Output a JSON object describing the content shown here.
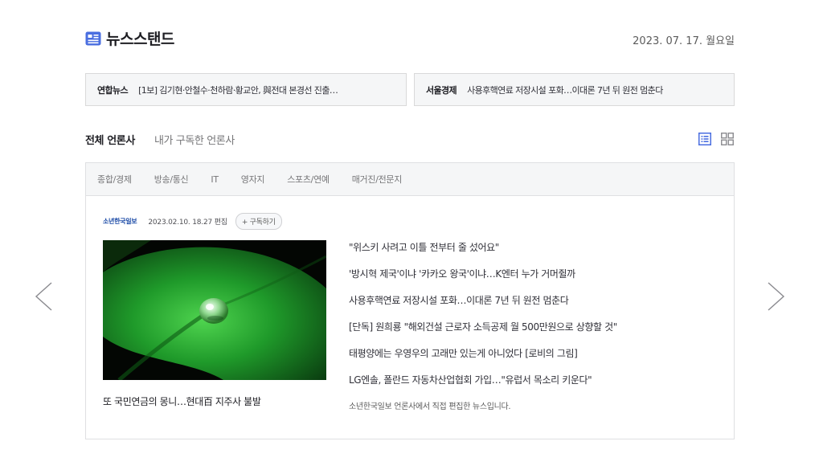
{
  "header": {
    "logo_icon": "newspaper-icon",
    "brand_color": "#4a6ee0",
    "title": "뉴스스탠드",
    "date": "2023. 07. 17. 월요일"
  },
  "rolling": [
    {
      "press": "연합뉴스",
      "headline": "[1보] 김기현·안철수·천하람·황교안, 與전대 본경선 진출…"
    },
    {
      "press": "서울경제",
      "headline": "사용후핵연료 저장시설 포화…이대론 7년 뒤 원전 멈춘다"
    }
  ],
  "tabs": {
    "all": "전체 언론사",
    "subscribed": "내가 구독한 언론사"
  },
  "view_icons": [
    "list-view-icon",
    "grid-view-icon"
  ],
  "categories": [
    "종합/경제",
    "방송/통신",
    "IT",
    "영자지",
    "스포츠/연예",
    "매거진/전문지"
  ],
  "press": {
    "name": "소년한국일보",
    "edit_time": "2023.02.10. 18.27 편집",
    "subscribe_label": "+ 구독하기",
    "main_caption": "또 국민연금의 몽니…현대百 지주사 불발",
    "news": [
      "\"위스키 사려고 이틀 전부터 줄 섰어요\"",
      "'방시혁 제국'이냐 '카카오 왕국'이냐…K엔터 누가 거머쥘까",
      "사용후핵연료 저장시설 포화…이대론 7년 뒤 원전 멈춘다",
      "[단독] 원희룡 \"해외건설 근로자 소득공제 월 500만원으로 상향할 것\"",
      "태평양에는 우영우의 고래만 있는게 아니었다 [로비의 그림]",
      "LG엔솔, 폴란드 자동차산업협회 가입…\"유럽서 목소리 키운다\""
    ],
    "notice": "소년한국일보 언론사에서 직접 편집한 뉴스입니다."
  },
  "nav": {
    "prev_icon": "chevron-left-icon",
    "next_icon": "chevron-right-icon"
  }
}
